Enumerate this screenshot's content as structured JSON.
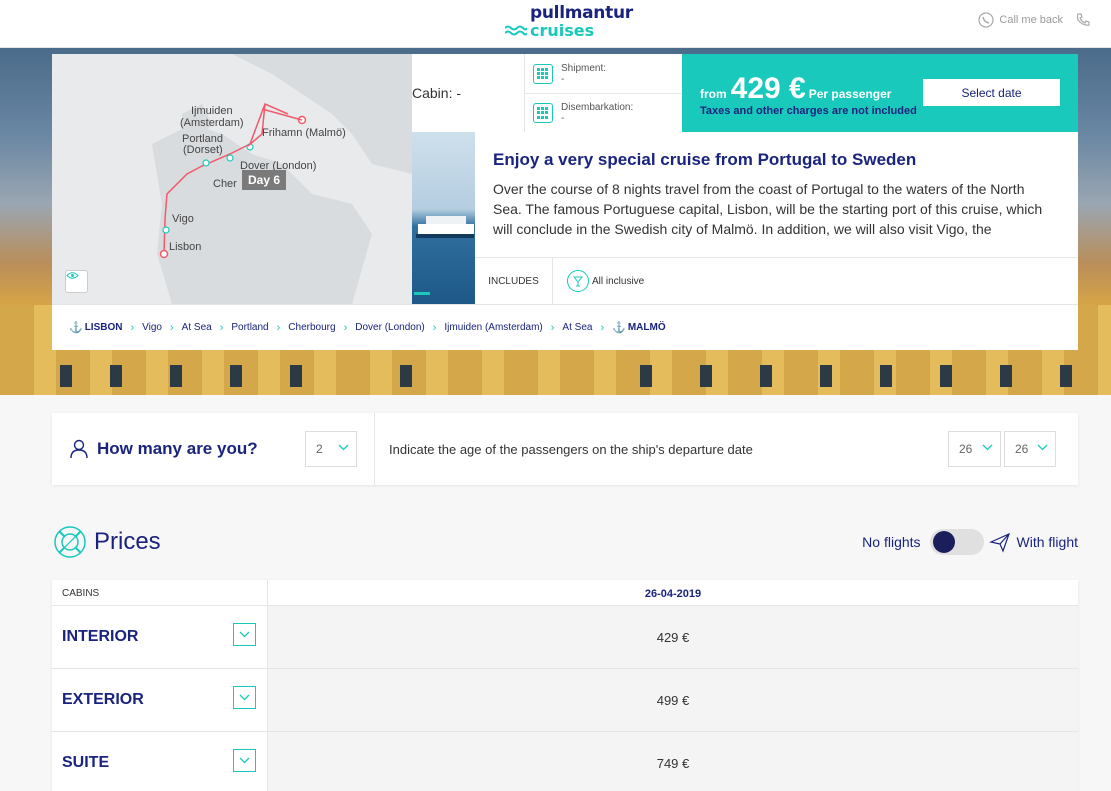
{
  "header": {
    "logo_top": "pullmantur",
    "logo_bottom": "cruises",
    "call_me_back": "Call me back"
  },
  "map": {
    "labels": {
      "ijmuiden": "Ijmuiden",
      "amsterdam": "(Amsterdam)",
      "frihamn": "Frihamn (Malmö)",
      "portland": "Portland",
      "dorset": "(Dorset)",
      "dover": "Dover (London)",
      "cherbourg": "Cher",
      "vigo": "Vigo",
      "lisbon": "Lisbon"
    },
    "day_tag": "Day 6"
  },
  "cruise": {
    "cabin": "Cabin: -",
    "shipment_label": "Shipment:",
    "shipment_value": "-",
    "disembarkation_label": "Disembarkation:",
    "disembarkation_value": "-",
    "price_from": "from",
    "price_amount": "429 €",
    "price_per": "Per passenger",
    "price_note": "Taxes and other charges are not included",
    "select_date": "Select date",
    "title": "Enjoy a very special cruise from Portugal to Sweden",
    "description": "Over the course of 8 nights travel from the coast of Portugal to the waters of the North Sea. The famous Portuguese capital, Lisbon, will be the starting port of this cruise, which will conclude in the Swedish city of Malmö. In addition, we will also visit Vigo, the",
    "includes_label": "INCLUDES",
    "includes_item": "All inclusive"
  },
  "itinerary": [
    "LISBON",
    "Vigo",
    "At Sea",
    "Portland",
    "Cherbourg",
    "Dover (London)",
    "Ijmuiden (Amsterdam)",
    "At Sea",
    "MALMÖ"
  ],
  "passengers": {
    "title": "How many are you?",
    "count": "2",
    "instruction": "Indicate the age of the passengers on the ship's departure date",
    "ages": [
      "26",
      "26"
    ]
  },
  "prices": {
    "title": "Prices",
    "no_flights": "No flights",
    "with_flight": "With flight",
    "col_cabins": "CABINS",
    "col_date": "26-04-2019",
    "rows": [
      {
        "cabin": "INTERIOR",
        "price": "429 €"
      },
      {
        "cabin": "EXTERIOR",
        "price": "499 €"
      },
      {
        "cabin": "SUITE",
        "price": "749 €"
      }
    ]
  },
  "colors": {
    "navy": "#1a237e",
    "teal": "#19c9bb",
    "route": "#f05a6a"
  }
}
